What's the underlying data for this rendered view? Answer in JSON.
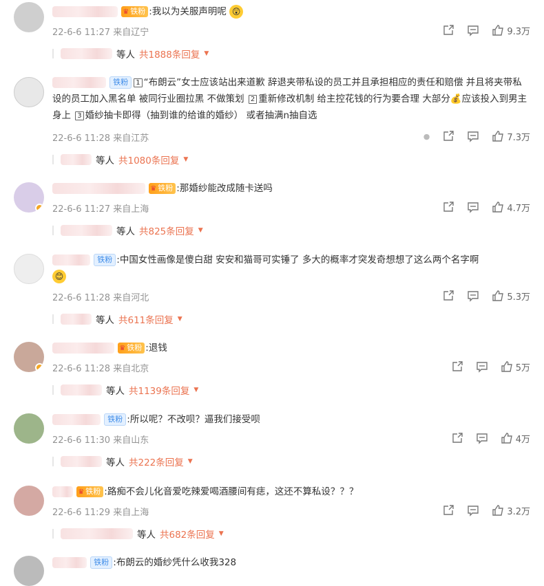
{
  "comments": [
    {
      "user_blur_w": 95,
      "badge": "铁粉",
      "badge_style": "gold",
      "text": ":我以为关服声明呢",
      "meta": "22-6-6 11:27 来自辽宁",
      "likes": "9.3万",
      "reply_people": "等人",
      "reply_count": "共1888条回复",
      "avatar_color": "#cfcfcf"
    },
    {
      "user_blur_w": 85,
      "badge": "铁粉",
      "badge_style": "blue",
      "text_parts": [
        {
          "box": "1"
        },
        {
          "t": "“布朗云”女士应该站出来道歉 辞退夹带私设的员工并且承担相应的责任和赔偿 并且将夹带私设的员工加入黑名单 被同行业圈拉黑  不做策划 "
        },
        {
          "box": "2"
        },
        {
          "t": "重新修改机制 给主控花钱的行为要合理 大部分"
        },
        {
          "emoji": "💰"
        },
        {
          "t": "应该投入到男主身上 "
        },
        {
          "box": "3"
        },
        {
          "t": "婚纱抽卡即得（抽到谁的给谁的婚纱） 或者抽满n抽自选"
        }
      ],
      "meta": "22-6-6 11:28 来自江苏",
      "likes": "7.3万",
      "reply_people": "等人",
      "reply_count": "共1080条回复",
      "avatar_color": "#e8e8e8"
    },
    {
      "user_blur_w": 135,
      "badge": "铁粉",
      "badge_style": "gold",
      "text": ":那婚纱能改成随卡送吗",
      "meta": "22-6-6 11:27 来自上海",
      "likes": "4.7万",
      "reply_people": "等人",
      "reply_count": "共825条回复",
      "avatar_color": "#d9cde8"
    },
    {
      "user_blur_w": 55,
      "badge": "铁粉",
      "badge_style": "blue",
      "text": ":中国女性画像是傻白甜 安安和猫哥可实锤了 多大的概率才突发奇想想了这么两个名字啊",
      "meta": "22-6-6 11:28 来自河北",
      "likes": "5.3万",
      "reply_people": "等人",
      "reply_count": "共611条回复",
      "avatar_color": "#eeeeee"
    },
    {
      "user_blur_w": 90,
      "badge": "铁粉",
      "badge_style": "gold",
      "text": ":退钱",
      "meta": "22-6-6 11:28 来自北京",
      "likes": "5万",
      "reply_people": "等人",
      "reply_count": "共1139条回复",
      "avatar_color": "#c9a89a"
    },
    {
      "user_blur_w": 70,
      "badge": "铁粉",
      "badge_style": "blue",
      "text": ":所以呢？不改呗？逼我们接受呗",
      "meta": "22-6-6 11:30 来自山东",
      "likes": "4万",
      "reply_people": "等人",
      "reply_count": "共222条回复",
      "avatar_color": "#9db58a"
    },
    {
      "user_blur_w": 30,
      "badge": "铁粉",
      "badge_style": "gold",
      "text": ":路痴不会儿化音爱吃辣爱喝酒腰间有痣，这还不算私设？？？",
      "meta": "22-6-6 11:29 来自上海",
      "likes": "3.2万",
      "reply_people": "等人",
      "reply_count": "共682条回复",
      "avatar_color": "#d4a9a3"
    },
    {
      "user_blur_w": 50,
      "badge": "铁粉",
      "badge_style": "blue",
      "text": ":布朗云的婚纱凭什么收我328",
      "meta": "",
      "likes": "",
      "reply_people": "",
      "reply_count": "",
      "avatar_color": "#bbbbbb"
    }
  ],
  "icons": {
    "share": "share-icon",
    "comment": "comment-icon",
    "like": "thumb-up-icon",
    "more": "more-icon"
  },
  "colors": {
    "accent": "#eb7350",
    "meta": "#939393",
    "badge_blue": "#3d8be8",
    "badge_gold": "#ff9f1a"
  }
}
